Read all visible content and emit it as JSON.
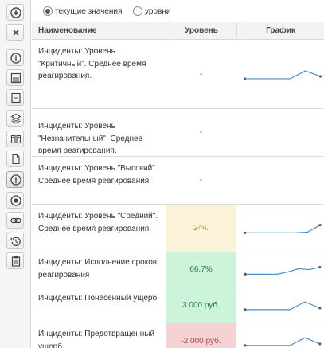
{
  "toolbar": {
    "buttons": [
      {
        "name": "add-icon"
      },
      {
        "name": "close-icon"
      },
      {
        "name": "info-icon"
      },
      {
        "name": "calendar-icon"
      },
      {
        "name": "list-icon"
      },
      {
        "name": "layers-icon"
      },
      {
        "name": "book-icon"
      },
      {
        "name": "document-icon"
      },
      {
        "name": "indicator-icon",
        "active": true
      },
      {
        "name": "target-icon"
      },
      {
        "name": "link-icon"
      },
      {
        "name": "history-icon"
      },
      {
        "name": "clipboard-icon"
      }
    ]
  },
  "view_mode": {
    "options": [
      "текущие значения",
      "уровни"
    ],
    "selected": "текущие значения"
  },
  "table": {
    "headers": {
      "name": "Наименование",
      "level": "Уровень",
      "graph": "График"
    },
    "rows": [
      {
        "name": "Инциденты: Уровень \"Критичный\". Среднее время реагирования.",
        "level": "-",
        "level_color": "",
        "level_bg": "",
        "trend": [
          0,
          0,
          0,
          0,
          1,
          0.3
        ],
        "has_graph": true
      },
      {
        "name": "Инциденты: Уровень \"Незначительный\". Среднее время реагирования.",
        "level": "-",
        "level_color": "",
        "level_bg": "",
        "trend": [],
        "has_graph": false
      },
      {
        "name": "Инциденты: Уровень \"Высокий\". Среднее время реагирования.",
        "level": "-",
        "level_color": "",
        "level_bg": "",
        "trend": [],
        "has_graph": false
      },
      {
        "name": "Инциденты: Уровень \"Средний\". Среднее время реагирования.",
        "level": "24ч.",
        "level_color": "#b08a2e",
        "level_bg": "#fbf3d8",
        "trend": [
          0,
          0,
          0,
          0,
          0,
          0.1,
          1
        ],
        "has_graph": true
      },
      {
        "name": "Инциденты: Исполнение сроков реагирования",
        "level": "66.7%",
        "level_color": "#2e7d4f",
        "level_bg": "#cdf3db",
        "trend": [
          0,
          0,
          0,
          0,
          0.3,
          0.7,
          0.6,
          0.9
        ],
        "has_graph": true
      },
      {
        "name": "Инциденты: Понесенный ущерб",
        "level": "3 000 руб.",
        "level_color": "#2e7d4f",
        "level_bg": "#cdf3db",
        "trend": [
          0,
          0,
          0,
          0,
          1,
          0.2
        ],
        "has_graph": true
      },
      {
        "name": "Инциденты: Предотвращенный ущерб",
        "level": "-2 000 руб.",
        "level_color": "#b3424a",
        "level_bg": "#f5d3d5",
        "trend": [
          0,
          0,
          0,
          0,
          1,
          0.2
        ],
        "has_graph": true
      }
    ]
  },
  "colors": {
    "sparkline": "#4a8ec7",
    "border": "#dcdcdc"
  }
}
